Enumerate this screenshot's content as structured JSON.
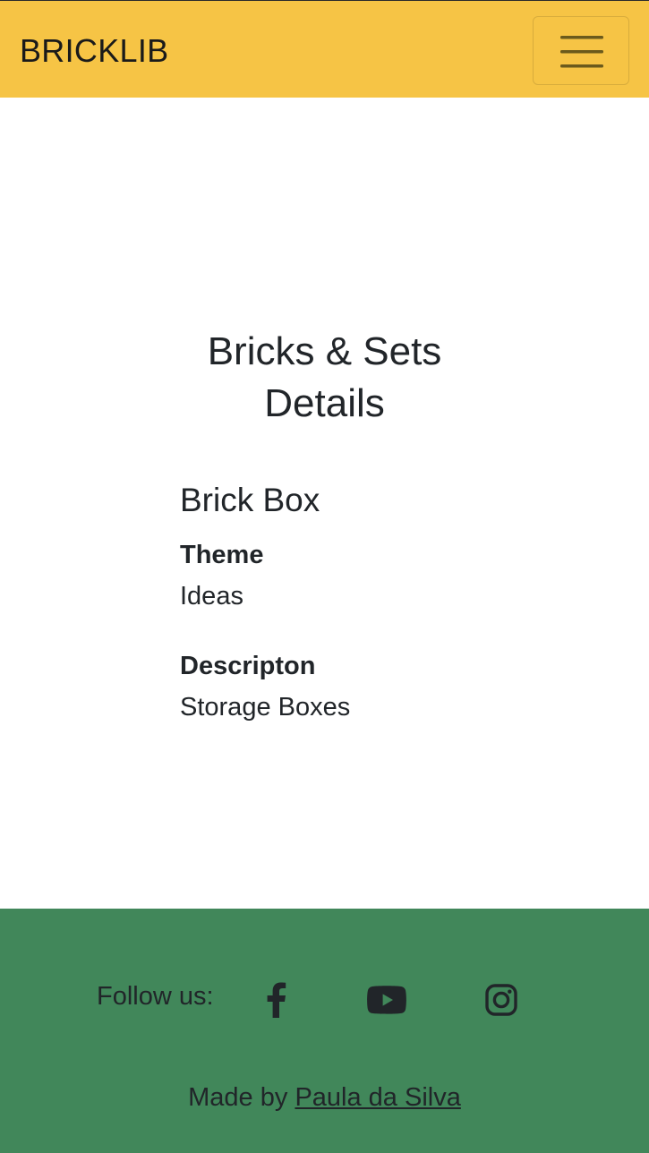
{
  "navbar": {
    "brand": "BRICKLIB",
    "background": "#f6c445",
    "toggler_icon": "hamburger-menu-icon"
  },
  "main": {
    "title_line1": "Bricks & Sets",
    "title_line2": "Details",
    "item_name": "Brick Box",
    "fields": [
      {
        "term": "Theme",
        "value": "Ideas"
      },
      {
        "term": "Descripton",
        "value": "Storage Boxes"
      }
    ]
  },
  "footer": {
    "background": "#41875a",
    "follow_label": "Follow us:",
    "social_icons": [
      "facebook-icon",
      "youtube-icon",
      "instagram-icon"
    ],
    "made_by_prefix": "Made by ",
    "author_link": "Paula da Silva"
  }
}
